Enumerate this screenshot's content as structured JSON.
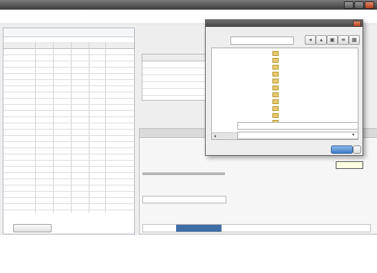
{
  "window": {
    "title": ""
  },
  "menu": {
    "file": ""
  },
  "left_panel": {
    "title": "",
    "columns": [
      "",
      "",
      "",
      "",
      "",
      ""
    ],
    "rows": [
      [
        "",
        "",
        "",
        "",
        "",
        ""
      ],
      [
        "",
        "",
        "",
        "",
        "",
        ""
      ],
      [
        "",
        "",
        "",
        "",
        "",
        ""
      ],
      [
        "",
        "",
        "",
        "",
        "",
        ""
      ],
      [
        "",
        "",
        "",
        "",
        "",
        ""
      ],
      [
        "",
        "",
        "",
        "",
        "",
        ""
      ],
      [
        "",
        "",
        "",
        "",
        "",
        ""
      ],
      [
        "",
        "",
        "",
        "",
        "",
        ""
      ],
      [
        "",
        "",
        "",
        "",
        "",
        ""
      ],
      [
        "",
        "",
        "",
        "",
        "",
        ""
      ],
      [
        "",
        "",
        "",
        "",
        "",
        ""
      ],
      [
        "",
        "",
        "",
        "",
        "",
        ""
      ],
      [
        "",
        "",
        "",
        "",
        "",
        ""
      ],
      [
        "",
        "",
        "",
        "",
        "",
        ""
      ],
      [
        "",
        "",
        "",
        "",
        "",
        ""
      ],
      [
        "",
        "",
        "",
        "",
        "",
        ""
      ],
      [
        "",
        "",
        "",
        "",
        "",
        ""
      ],
      [
        "",
        "",
        "",
        "",
        "",
        ""
      ],
      [
        "",
        "",
        "",
        "",
        "",
        ""
      ],
      [
        "",
        "",
        "",
        "",
        "",
        ""
      ],
      [
        "",
        "",
        "",
        "",
        "",
        ""
      ],
      [
        "",
        "",
        "",
        "",
        "",
        ""
      ],
      [
        "",
        "",
        "",
        "",
        "",
        ""
      ],
      [
        "",
        "",
        "",
        "",
        "",
        ""
      ],
      [
        "",
        "",
        "",
        "",
        "",
        ""
      ],
      [
        "",
        "",
        "",
        "",
        "",
        ""
      ],
      [
        "",
        "",
        "",
        "",
        "",
        ""
      ]
    ],
    "button": ""
  },
  "center": {
    "header": "",
    "subtitle": "",
    "table_columns": [
      "",
      "",
      ""
    ],
    "table_rows": [
      [
        "",
        "",
        ""
      ],
      [
        "",
        "",
        ""
      ],
      [
        "",
        "",
        ""
      ],
      [
        "",
        "",
        ""
      ],
      [
        "",
        "",
        ""
      ]
    ]
  },
  "lower_panel": {
    "header": "",
    "lines": [
      "",
      "",
      "",
      "",
      "",
      "",
      "",
      ""
    ],
    "tabs": [
      "",
      "",
      "",
      "",
      "",
      ""
    ]
  },
  "dialog": {
    "title": "",
    "path_label": "",
    "path_value": "",
    "items": [
      "",
      "",
      "",
      "",
      "",
      "",
      "",
      "",
      "",
      "",
      ""
    ],
    "name_label": "",
    "name_value": "",
    "type_label": "",
    "type_value": "",
    "ok_label": "",
    "cancel_label": ""
  },
  "tooltip": "",
  "footer": {
    "lines": [
      "",
      "",
      "",
      "",
      "",
      "",
      "",
      "",
      ""
    ]
  },
  "colors": {
    "accent": "#3f6ea6",
    "selection": "#23439a",
    "close": "#b33c1c"
  }
}
